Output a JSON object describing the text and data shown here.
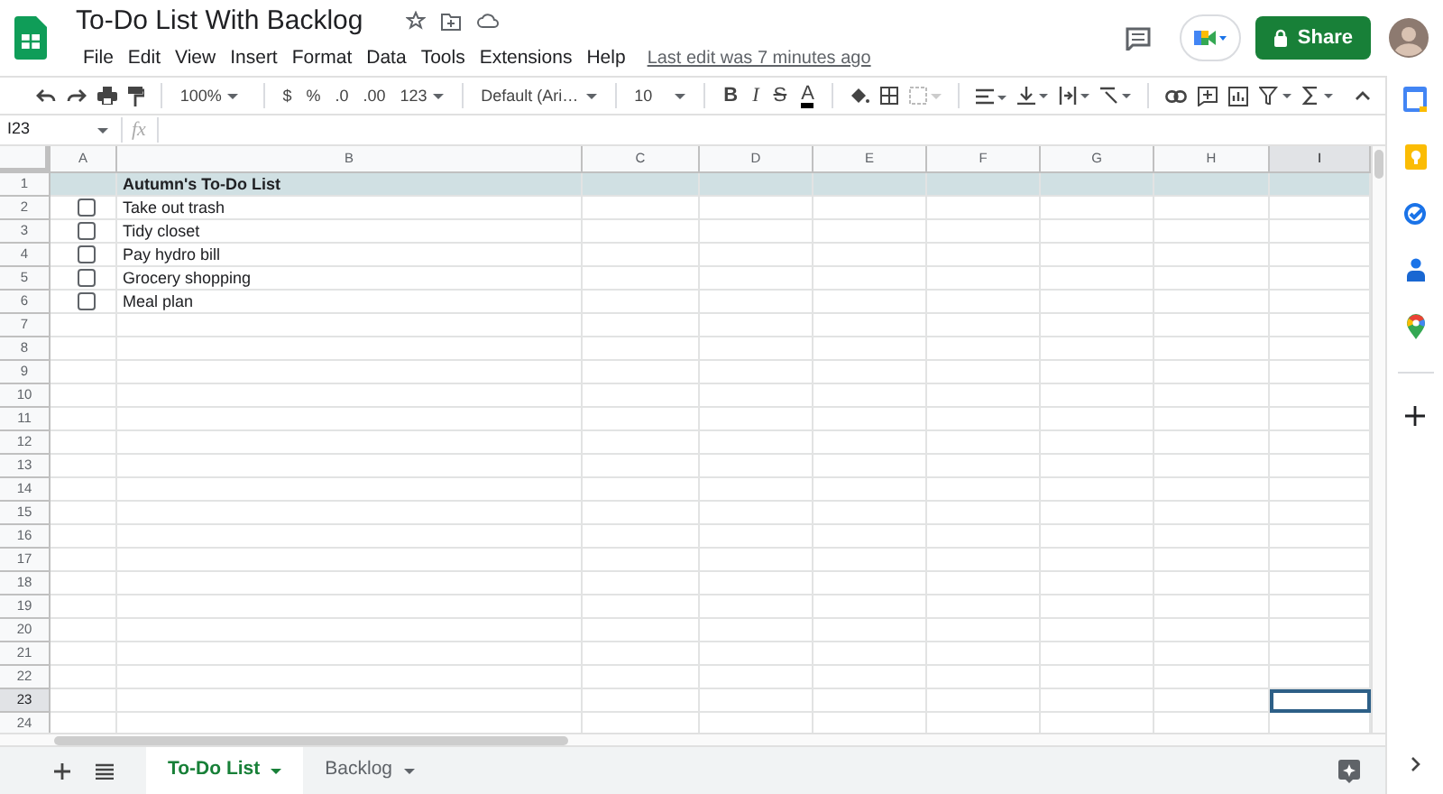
{
  "document": {
    "title": "To-Do List With Backlog",
    "last_edit": "Last edit was 7 minutes ago",
    "share_label": "Share"
  },
  "menus": [
    "File",
    "Edit",
    "View",
    "Insert",
    "Format",
    "Data",
    "Tools",
    "Extensions",
    "Help"
  ],
  "toolbar": {
    "zoom": "100%",
    "currency": "$",
    "percent": "%",
    "decimal_decrease": ".0",
    "decimal_increase": ".00",
    "number_format": "123",
    "font": "Default (Ari…",
    "font_size": "10",
    "bold": "B",
    "italic": "I",
    "strikethrough": "S",
    "text_color": "A"
  },
  "formula_bar": {
    "name_box": "I23",
    "fx": "fx"
  },
  "columns": [
    {
      "label": "A",
      "selected": false
    },
    {
      "label": "B",
      "selected": false
    },
    {
      "label": "C",
      "selected": false
    },
    {
      "label": "D",
      "selected": false
    },
    {
      "label": "E",
      "selected": false
    },
    {
      "label": "F",
      "selected": false
    },
    {
      "label": "G",
      "selected": false
    },
    {
      "label": "H",
      "selected": false
    },
    {
      "label": "I",
      "selected": true
    }
  ],
  "rows": [
    {
      "number": "1",
      "selected": false,
      "kind": "title",
      "text": "Autumn's To-Do List"
    },
    {
      "number": "2",
      "selected": false,
      "kind": "task",
      "checked": false,
      "text": "Take out trash"
    },
    {
      "number": "3",
      "selected": false,
      "kind": "task",
      "checked": false,
      "text": "Tidy closet"
    },
    {
      "number": "4",
      "selected": false,
      "kind": "task",
      "checked": false,
      "text": "Pay hydro bill"
    },
    {
      "number": "5",
      "selected": false,
      "kind": "task",
      "checked": false,
      "text": "Grocery shopping"
    },
    {
      "number": "6",
      "selected": false,
      "kind": "task",
      "checked": false,
      "text": "Meal plan"
    },
    {
      "number": "7",
      "selected": false,
      "kind": "empty"
    },
    {
      "number": "8",
      "selected": false,
      "kind": "empty"
    },
    {
      "number": "9",
      "selected": false,
      "kind": "empty"
    },
    {
      "number": "10",
      "selected": false,
      "kind": "empty"
    },
    {
      "number": "11",
      "selected": false,
      "kind": "empty"
    },
    {
      "number": "12",
      "selected": false,
      "kind": "empty"
    },
    {
      "number": "13",
      "selected": false,
      "kind": "empty"
    },
    {
      "number": "14",
      "selected": false,
      "kind": "empty"
    },
    {
      "number": "15",
      "selected": false,
      "kind": "empty"
    },
    {
      "number": "16",
      "selected": false,
      "kind": "empty"
    },
    {
      "number": "17",
      "selected": false,
      "kind": "empty"
    },
    {
      "number": "18",
      "selected": false,
      "kind": "empty"
    },
    {
      "number": "19",
      "selected": false,
      "kind": "empty"
    },
    {
      "number": "20",
      "selected": false,
      "kind": "empty"
    },
    {
      "number": "21",
      "selected": false,
      "kind": "empty"
    },
    {
      "number": "22",
      "selected": false,
      "kind": "empty"
    },
    {
      "number": "23",
      "selected": true,
      "kind": "empty"
    },
    {
      "number": "24",
      "selected": false,
      "kind": "empty"
    }
  ],
  "sheet_tabs": [
    {
      "label": "To-Do List",
      "selected": true
    },
    {
      "label": "Backlog",
      "selected": false
    }
  ]
}
